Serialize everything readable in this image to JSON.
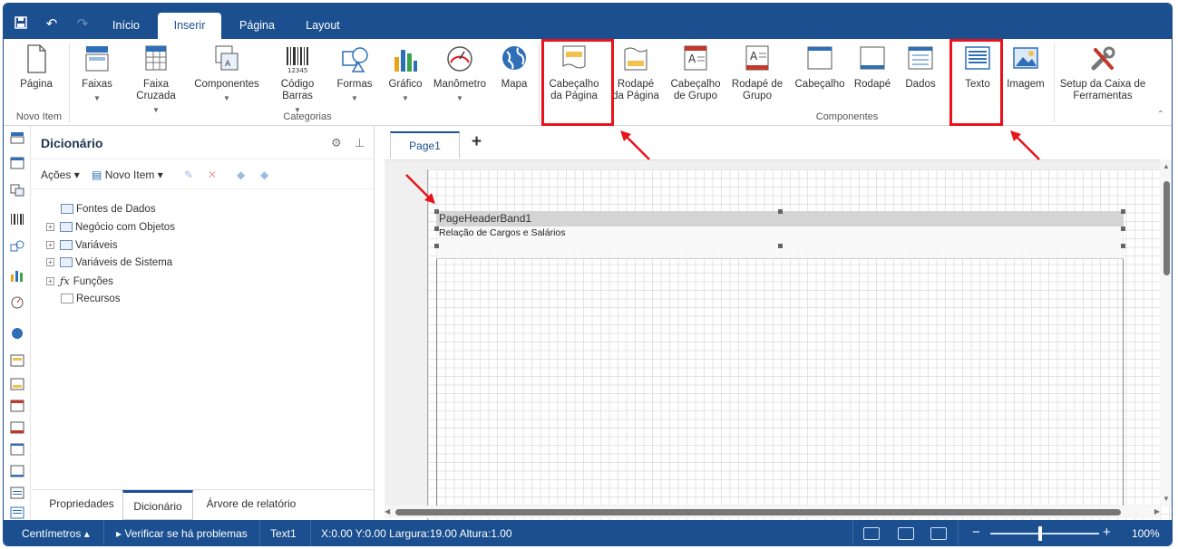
{
  "tabs": [
    {
      "label": "Início"
    },
    {
      "label": "Inserir"
    },
    {
      "label": "Página"
    },
    {
      "label": "Layout"
    }
  ],
  "ribbon": {
    "pagina": "Página",
    "faixas": "Faixas",
    "faixa_cruzada": "Faixa Cruzada",
    "componentes": "Componentes",
    "codigo_barras": "Código Barras",
    "formas": "Formas",
    "grafico": "Gráfico",
    "manometro": "Manômetro",
    "mapa": "Mapa",
    "cabecalho_pagina": "Cabeçalho da Página",
    "rodape_pagina": "Rodapé da Página",
    "cabecalho_grupo": "Cabeçalho de Grupo",
    "rodape_grupo": "Rodapé de Grupo",
    "cabecalho": "Cabeçalho",
    "rodape": "Rodapé",
    "dados": "Dados",
    "texto": "Texto",
    "imagem": "Imagem",
    "setup": "Setup da Caixa de Ferramentas",
    "grp_novo_item": "Novo Item",
    "grp_categorias": "Categorias",
    "grp_componentes": "Componentes"
  },
  "dict": {
    "title": "Dicionário",
    "acoes": "Ações",
    "novo_item": "Novo Item",
    "tree": [
      {
        "label": "Fontes de Dados"
      },
      {
        "label": "Negócio com Objetos"
      },
      {
        "label": "Variáveis"
      },
      {
        "label": "Variáveis de Sistema"
      },
      {
        "label": "Funções"
      },
      {
        "label": "Recursos"
      }
    ]
  },
  "panel_tabs": [
    {
      "label": "Propriedades"
    },
    {
      "label": "Dicionário"
    },
    {
      "label": "Árvore de relatório"
    }
  ],
  "canvas": {
    "page_tab": "Page1",
    "add": "+",
    "band_name": "PageHeaderBand1",
    "band_text": "Relação de Cargos e Salários"
  },
  "status": {
    "units": "Centímetros",
    "check": "Verificar se há problemas",
    "selected": "Text1",
    "coords": "X:0.00 Y:0.00 Largura:19.00 Altura:1.00",
    "zoom": "100%",
    "minus": "−",
    "plus": "+"
  },
  "colors": {
    "brand": "#1b4f8f",
    "highlight": "#e8131b"
  }
}
